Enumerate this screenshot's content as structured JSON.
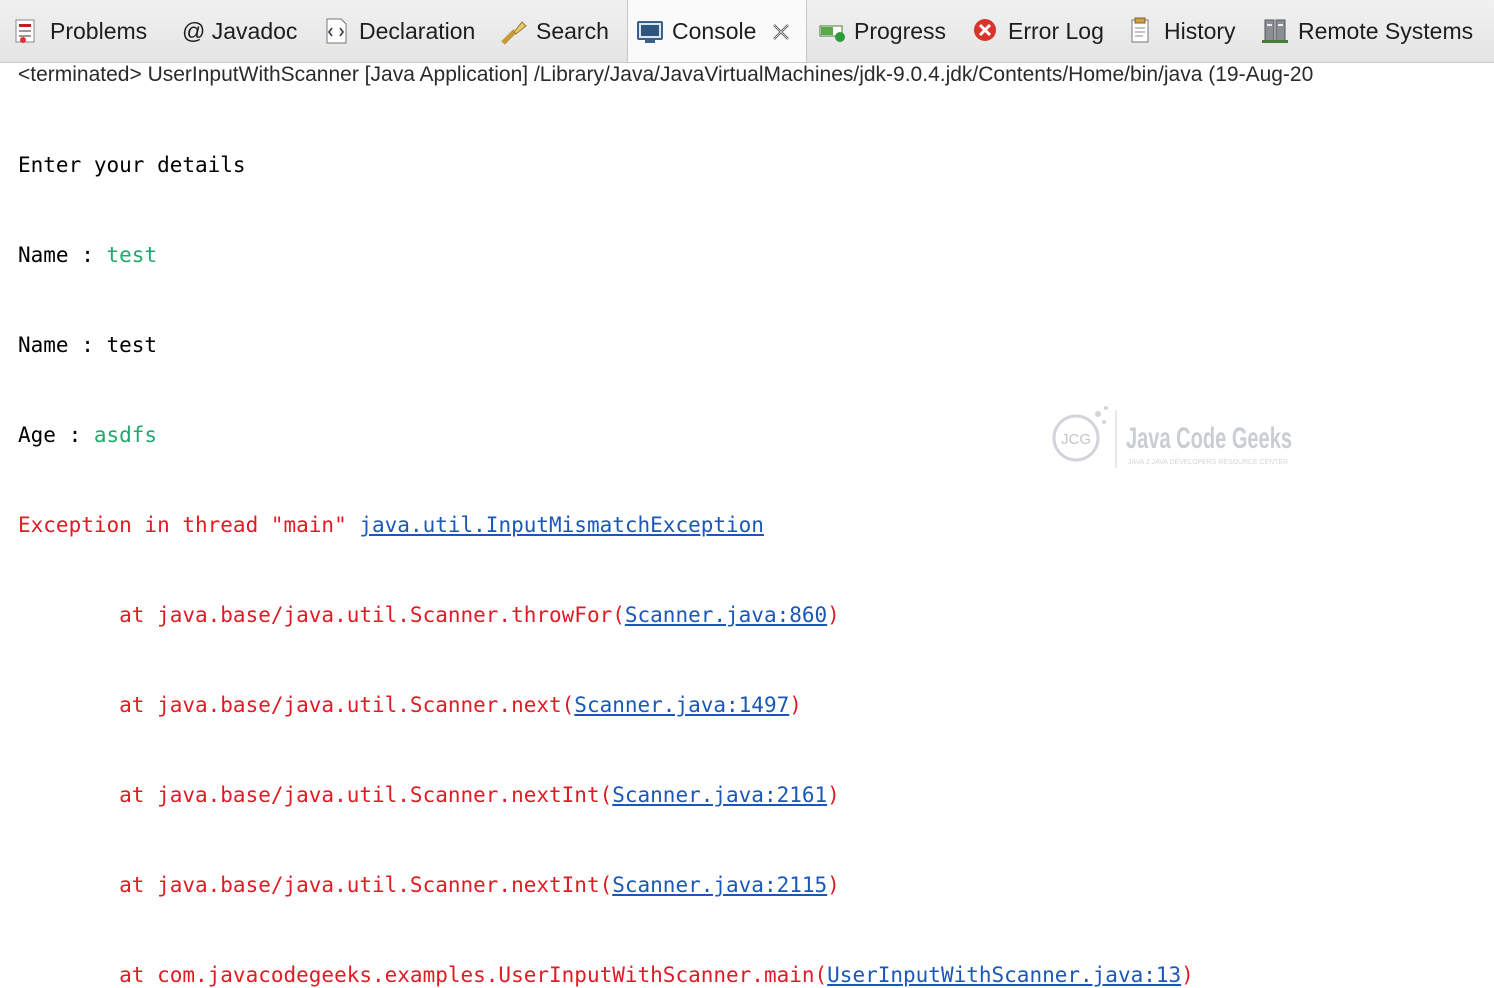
{
  "tabs": [
    {
      "label": "Problems",
      "icon": "problems-icon"
    },
    {
      "label": "@ Javadoc",
      "icon": "javadoc-icon"
    },
    {
      "label": "Declaration",
      "icon": "declaration-icon"
    },
    {
      "label": "Search",
      "icon": "search-icon"
    },
    {
      "label": "Console",
      "icon": "console-icon",
      "active": true
    },
    {
      "label": "Progress",
      "icon": "progress-icon"
    },
    {
      "label": "Error Log",
      "icon": "error-log-icon"
    },
    {
      "label": "History",
      "icon": "history-icon"
    },
    {
      "label": "Remote Systems",
      "icon": "remote-systems-icon"
    }
  ],
  "status": "<terminated> UserInputWithScanner [Java Application] /Library/Java/JavaVirtualMachines/jdk-9.0.4.jdk/Contents/Home/bin/java (19-Aug-20",
  "console": {
    "l1": "Enter your details",
    "l2_prompt": "Name : ",
    "l2_input": "test",
    "l3": "Name : test",
    "l4_prompt": "Age : ",
    "l4_input": "asdfs",
    "exc_prefix": "Exception in thread \"main\" ",
    "exc_link": "java.util.InputMismatchException",
    "frames": [
      {
        "pre": "        at java.base/java.util.Scanner.throwFor(",
        "link": "Scanner.java:860",
        "post": ")"
      },
      {
        "pre": "        at java.base/java.util.Scanner.next(",
        "link": "Scanner.java:1497",
        "post": ")"
      },
      {
        "pre": "        at java.base/java.util.Scanner.nextInt(",
        "link": "Scanner.java:2161",
        "post": ")"
      },
      {
        "pre": "        at java.base/java.util.Scanner.nextInt(",
        "link": "Scanner.java:2115",
        "post": ")"
      },
      {
        "pre": "        at com.javacodegeeks.examples.UserInputWithScanner.main(",
        "link": "UserInputWithScanner.java:13",
        "post": ")"
      }
    ]
  },
  "watermark": {
    "logo_text": "JCG",
    "title": "Java Code Geeks",
    "tagline": "JAVA 2 JAVA DEVELOPERS RESOURCE CENTER"
  },
  "colors": {
    "input": "#22a86c",
    "error": "#e01b24",
    "link": "#1a57b9"
  }
}
